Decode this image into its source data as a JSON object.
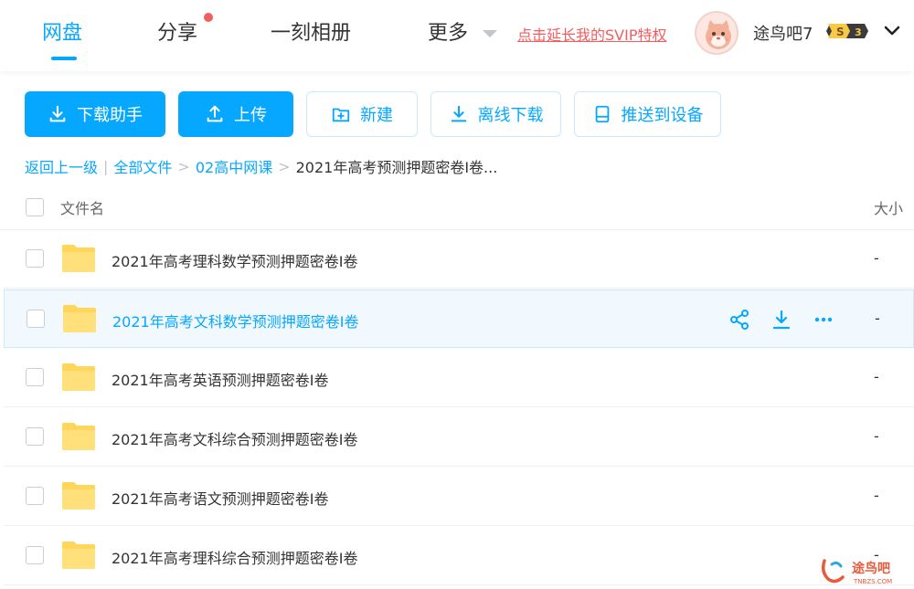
{
  "nav": {
    "tabs": [
      {
        "label": "网盘",
        "active": true
      },
      {
        "label": "分享",
        "has_dot": true
      },
      {
        "label": "一刻相册"
      },
      {
        "label": "更多",
        "has_dropdown": true
      }
    ],
    "promo_link": "点击延长我的SVIP特权",
    "username": "途鸟吧7",
    "vip_badge": {
      "letter": "S",
      "level": "3"
    }
  },
  "toolbar": {
    "download_helper": "下载助手",
    "upload": "上传",
    "new": "新建",
    "offline_download": "离线下载",
    "push_to_device": "推送到设备"
  },
  "breadcrumb": {
    "back": "返回上一级",
    "all_files": "全部文件",
    "parent": "02高中网课",
    "current": "2021年高考预测押题密卷Ⅰ卷..."
  },
  "list": {
    "col_name": "文件名",
    "col_size": "大小",
    "rows": [
      {
        "name": "2021年高考理科数学预测押题密卷I卷",
        "size": "-"
      },
      {
        "name": "2021年高考文科数学预测押题密卷I卷",
        "size": "-",
        "hovered": true
      },
      {
        "name": "2021年高考英语预测押题密卷I卷",
        "size": "-"
      },
      {
        "name": "2021年高考文科综合预测押题密卷I卷",
        "size": "-"
      },
      {
        "name": "2021年高考语文预测押题密卷I卷",
        "size": "-"
      },
      {
        "name": "2021年高考理科综合预测押题密卷I卷",
        "size": "-"
      }
    ]
  },
  "watermark": {
    "text": "途鸟吧",
    "sub": "TNBZS.COM"
  },
  "colors": {
    "accent": "#06a7ff",
    "promo": "#f25d5d",
    "folder": "#ffd659"
  }
}
